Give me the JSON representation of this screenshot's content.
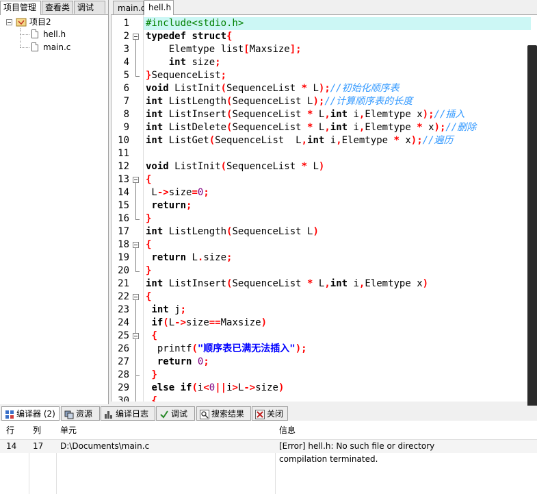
{
  "left_panel": {
    "tabs": [
      "项目管理",
      "查看类",
      "调试"
    ],
    "tree": {
      "project": "项目2",
      "files": [
        "hell.h",
        "main.c"
      ]
    }
  },
  "editor": {
    "tabs": [
      "main.c",
      "hell.h"
    ],
    "active_tab": "hell.h",
    "lines": [
      [
        [
          "#include<stdio.h>",
          "pp"
        ]
      ],
      [
        [
          "typedef",
          "kw"
        ],
        [
          " ",
          ""
        ],
        [
          "struct",
          "kw"
        ],
        [
          "{",
          "op"
        ]
      ],
      [
        [
          "    Elemtype list",
          ""
        ],
        [
          "[",
          "op"
        ],
        [
          "Maxsize",
          ""
        ],
        [
          "];",
          "op"
        ]
      ],
      [
        [
          "    ",
          ""
        ],
        [
          "int",
          "kw"
        ],
        [
          " size",
          ""
        ],
        [
          ";",
          "op"
        ]
      ],
      [
        [
          "}",
          "op"
        ],
        [
          "SequenceList",
          ""
        ],
        [
          ";",
          "op"
        ]
      ],
      [
        [
          "void",
          "kw"
        ],
        [
          " ListInit",
          ""
        ],
        [
          "(",
          "op"
        ],
        [
          "SequenceList ",
          ""
        ],
        [
          "*",
          "op"
        ],
        [
          " L",
          ""
        ],
        [
          ");",
          "op"
        ],
        [
          "//初始化顺序表",
          "cm"
        ]
      ],
      [
        [
          "int",
          "kw"
        ],
        [
          " ListLength",
          ""
        ],
        [
          "(",
          "op"
        ],
        [
          "SequenceList L",
          ""
        ],
        [
          ");",
          "op"
        ],
        [
          "//计算顺序表的长度",
          "cm"
        ]
      ],
      [
        [
          "int",
          "kw"
        ],
        [
          " ListInsert",
          ""
        ],
        [
          "(",
          "op"
        ],
        [
          "SequenceList ",
          ""
        ],
        [
          "*",
          "op"
        ],
        [
          " L",
          ""
        ],
        [
          ",",
          "op"
        ],
        [
          "int",
          "kw"
        ],
        [
          " i",
          ""
        ],
        [
          ",",
          "op"
        ],
        [
          "Elemtype x",
          ""
        ],
        [
          ");",
          "op"
        ],
        [
          "//插入",
          "cm"
        ]
      ],
      [
        [
          "int",
          "kw"
        ],
        [
          " ListDelete",
          ""
        ],
        [
          "(",
          "op"
        ],
        [
          "SequenceList ",
          ""
        ],
        [
          "*",
          "op"
        ],
        [
          " L",
          ""
        ],
        [
          ",",
          "op"
        ],
        [
          "int",
          "kw"
        ],
        [
          " i",
          ""
        ],
        [
          ",",
          "op"
        ],
        [
          "Elemtype ",
          ""
        ],
        [
          "*",
          "op"
        ],
        [
          " x",
          ""
        ],
        [
          ");",
          "op"
        ],
        [
          "//删除",
          "cm"
        ]
      ],
      [
        [
          "int",
          "kw"
        ],
        [
          " ListGet",
          ""
        ],
        [
          "(",
          "op"
        ],
        [
          "SequenceList  L",
          ""
        ],
        [
          ",",
          "op"
        ],
        [
          "int",
          "kw"
        ],
        [
          " i",
          ""
        ],
        [
          ",",
          "op"
        ],
        [
          "Elemtype ",
          ""
        ],
        [
          "*",
          "op"
        ],
        [
          " x",
          ""
        ],
        [
          ");",
          "op"
        ],
        [
          "//遍历",
          "cm"
        ]
      ],
      [],
      [
        [
          "void",
          "kw"
        ],
        [
          " ListInit",
          ""
        ],
        [
          "(",
          "op"
        ],
        [
          "SequenceList ",
          ""
        ],
        [
          "*",
          "op"
        ],
        [
          " L",
          ""
        ],
        [
          ")",
          "op"
        ]
      ],
      [
        [
          "{",
          "op"
        ]
      ],
      [
        [
          " L",
          ""
        ],
        [
          "->",
          "op"
        ],
        [
          "size",
          ""
        ],
        [
          "=",
          "op"
        ],
        [
          "0",
          "nm"
        ],
        [
          ";",
          "op"
        ]
      ],
      [
        [
          " ",
          ""
        ],
        [
          "return",
          "kw"
        ],
        [
          ";",
          "op"
        ]
      ],
      [
        [
          "}",
          "op"
        ]
      ],
      [
        [
          "int",
          "kw"
        ],
        [
          " ListLength",
          ""
        ],
        [
          "(",
          "op"
        ],
        [
          "SequenceList L",
          ""
        ],
        [
          ")",
          "op"
        ]
      ],
      [
        [
          "{",
          "op"
        ]
      ],
      [
        [
          " ",
          ""
        ],
        [
          "return",
          "kw"
        ],
        [
          " L",
          ""
        ],
        [
          ".",
          "op"
        ],
        [
          "size",
          ""
        ],
        [
          ";",
          "op"
        ]
      ],
      [
        [
          "}",
          "op"
        ]
      ],
      [
        [
          "int",
          "kw"
        ],
        [
          " ListInsert",
          ""
        ],
        [
          "(",
          "op"
        ],
        [
          "SequenceList ",
          ""
        ],
        [
          "*",
          "op"
        ],
        [
          " L",
          ""
        ],
        [
          ",",
          "op"
        ],
        [
          "int",
          "kw"
        ],
        [
          " i",
          ""
        ],
        [
          ",",
          "op"
        ],
        [
          "Elemtype x",
          ""
        ],
        [
          ")",
          "op"
        ]
      ],
      [
        [
          "{",
          "op"
        ]
      ],
      [
        [
          " ",
          ""
        ],
        [
          "int",
          "kw"
        ],
        [
          " j",
          ""
        ],
        [
          ";",
          "op"
        ]
      ],
      [
        [
          " ",
          ""
        ],
        [
          "if",
          "kw"
        ],
        [
          "(",
          "op"
        ],
        [
          "L",
          ""
        ],
        [
          "->",
          "op"
        ],
        [
          "size",
          ""
        ],
        [
          "==",
          "op"
        ],
        [
          "Maxsize",
          ""
        ],
        [
          ")",
          "op"
        ]
      ],
      [
        [
          " ",
          ""
        ],
        [
          "{",
          "op"
        ]
      ],
      [
        [
          "  printf",
          ""
        ],
        [
          "(",
          "op"
        ],
        [
          "\"顺序表已满无法插入\"",
          "st"
        ],
        [
          ");",
          "op"
        ]
      ],
      [
        [
          "  ",
          ""
        ],
        [
          "return",
          "kw"
        ],
        [
          " ",
          ""
        ],
        [
          "0",
          "nm"
        ],
        [
          ";",
          "op"
        ]
      ],
      [
        [
          " ",
          ""
        ],
        [
          "}",
          "op"
        ]
      ],
      [
        [
          " ",
          ""
        ],
        [
          "else",
          "kw"
        ],
        [
          " ",
          ""
        ],
        [
          "if",
          "kw"
        ],
        [
          "(",
          "op"
        ],
        [
          "i",
          ""
        ],
        [
          "<",
          "op"
        ],
        [
          "0",
          "nm"
        ],
        [
          "||",
          "op"
        ],
        [
          "i",
          ""
        ],
        [
          ">",
          "op"
        ],
        [
          "L",
          ""
        ],
        [
          "->",
          "op"
        ],
        [
          "size",
          ""
        ],
        [
          ")",
          "op"
        ]
      ],
      [
        [
          " ",
          ""
        ],
        [
          "{",
          "op"
        ]
      ]
    ],
    "line_numbers": [
      "1",
      "2",
      "3",
      "4",
      "5",
      "6",
      "7",
      "8",
      "9",
      "10",
      "11",
      "12",
      "13",
      "14",
      "15",
      "16",
      "17",
      "18",
      "19",
      "20",
      "21",
      "22",
      "23",
      "24",
      "25",
      "26",
      "27",
      "28",
      "29",
      "30"
    ],
    "highlighted_line": 1,
    "fold_starts": [
      2,
      13,
      18,
      22,
      25
    ],
    "fold_ends": [
      5,
      16,
      20,
      28
    ]
  },
  "bottom_panel": {
    "tabs": [
      "编译器 (2)",
      "资源",
      "编译日志",
      "调试",
      "搜索结果",
      "关闭"
    ],
    "columns": [
      "行",
      "列",
      "单元",
      "信息"
    ],
    "rows": [
      {
        "line": "14",
        "col": "17",
        "unit": "D:\\Documents\\main.c",
        "info": "[Error] hell.h: No such file or directory"
      },
      {
        "line": "",
        "col": "",
        "unit": "",
        "info": "compilation terminated."
      }
    ]
  },
  "colors": {
    "highlight": "#ccf7f5",
    "keyword": "#000000",
    "operator": "#ff0000",
    "comment": "#3399ff",
    "string": "#0000ff",
    "preprocessor": "#008000"
  }
}
